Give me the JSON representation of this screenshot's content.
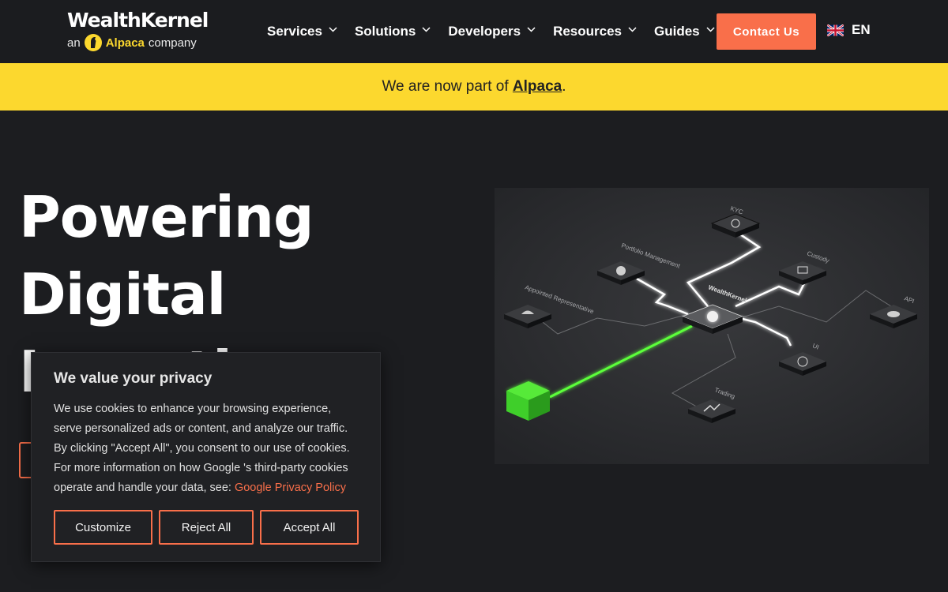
{
  "header": {
    "logo_main": "WealthKernel",
    "logo_sub_prefix": "an",
    "logo_sub_brand": "Alpaca",
    "logo_sub_suffix": "company",
    "nav": [
      {
        "label": "Services"
      },
      {
        "label": "Solutions"
      },
      {
        "label": "Developers"
      },
      {
        "label": "Resources"
      },
      {
        "label": "Guides"
      }
    ],
    "contact_label": "Contact Us",
    "language": "EN"
  },
  "banner": {
    "prefix": "We are now part of ",
    "link": "Alpaca",
    "suffix": "."
  },
  "hero": {
    "title_lines": [
      "Powering",
      "Digital",
      "Investing"
    ]
  },
  "diagram": {
    "center": "WealthKernel",
    "nodes": [
      "KYC",
      "Portfolio Management",
      "Custody",
      "Appointed Representative",
      "API",
      "UI",
      "Trading"
    ]
  },
  "cookie": {
    "title": "We value your privacy",
    "body": "We use cookies to enhance your browsing experience, serve personalized ads or content, and analyze our traffic. By clicking \"Accept All\", you consent to our use of cookies.",
    "body2": "For more information on how Google 's third-party cookies operate and handle your data, see: ",
    "link": "Google Privacy Policy",
    "buttons": {
      "customize": "Customize",
      "reject": "Reject All",
      "accept": "Accept All"
    }
  },
  "colors": {
    "accent": "#f96f4a",
    "banner": "#fcd82e",
    "background": "#1c1d20",
    "glow": "#5cff3a"
  }
}
